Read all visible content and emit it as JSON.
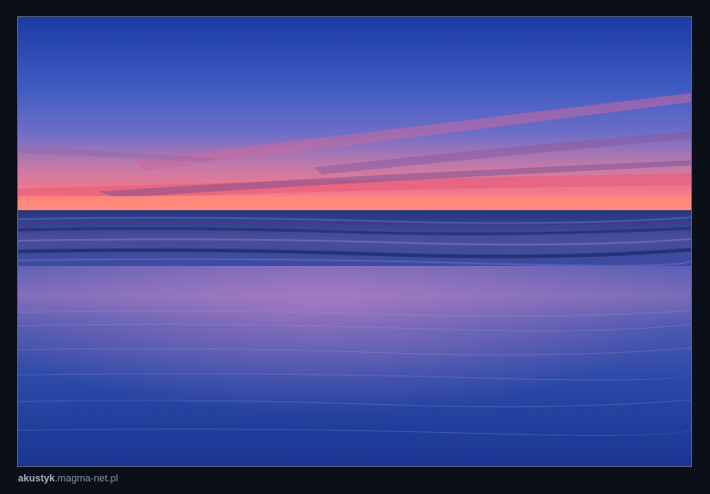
{
  "caption": {
    "author": "akustyk",
    "site": ".magma-net.pl"
  },
  "colors": {
    "frame_background": "#0a0f18",
    "photo_border": "#5c6675",
    "sky_top": "#1f3fa8",
    "sky_horizon_glow": "#f06a7a",
    "sea": "#1a2f80",
    "wet_sand": "#2540a0"
  }
}
